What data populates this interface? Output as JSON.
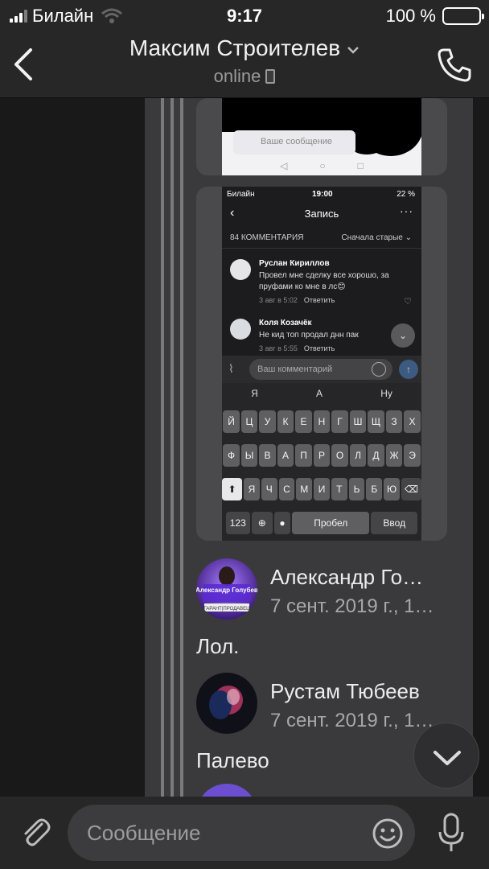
{
  "status_bar": {
    "carrier": "Билайн",
    "time": "9:17",
    "battery": "100 %"
  },
  "header": {
    "title": "Максим Строителев",
    "subtitle": "online"
  },
  "attachment_1": {
    "input_placeholder": "Ваше сообщение"
  },
  "attachment_2": {
    "status": {
      "carrier": "Билайн",
      "time": "19:00",
      "battery": "22 %"
    },
    "title": "Запись",
    "comments_count": "84 КОММЕНТАРИЯ",
    "sort": "Сначала старые",
    "comments": [
      {
        "author": "Руслан Кириллов",
        "text": "Провел мне сделку все хорошо, за пруфами ко мне в лс😊",
        "date": "3 авг в 5:02",
        "reply": "Ответить"
      },
      {
        "author": "Коля Козачёк",
        "text": "Не кид топ продал днн пак",
        "date": "3 авг в 5:55",
        "reply": "Ответить"
      }
    ],
    "input_placeholder": "Ваш комментарий",
    "suggestions": [
      "Я",
      "А",
      "Ну"
    ],
    "keyboard_rows": [
      [
        "Й",
        "Ц",
        "У",
        "К",
        "Е",
        "Н",
        "Г",
        "Ш",
        "Щ",
        "З",
        "Х"
      ],
      [
        "Ф",
        "Ы",
        "В",
        "А",
        "П",
        "Р",
        "О",
        "Л",
        "Д",
        "Ж",
        "Э"
      ],
      [
        "Я",
        "Ч",
        "С",
        "М",
        "И",
        "Т",
        "Ь",
        "Б",
        "Ю"
      ]
    ],
    "key_123": "123",
    "key_space": "Пробел",
    "key_enter": "Ввод"
  },
  "messages": [
    {
      "author": "Александр Го…",
      "date": "7 сент. 2019 г., 1…",
      "text": "Лол.",
      "avatar_label": "Александр Голубев",
      "avatar_sub": "ГАРАНТ|ПРОДАВЕЦ"
    },
    {
      "author": "Рустам Тюбеев",
      "date": "7 сент. 2019 г., 1…",
      "text": "Палево"
    }
  ],
  "compose": {
    "placeholder": "Сообщение"
  },
  "colors": {
    "bar_bg": "#272727",
    "thread_bg": "#3a3a3c",
    "bubble_bg": "#4a4a4c",
    "text": "#ececec",
    "muted": "#a8a8a8"
  },
  "icons": [
    "back-icon",
    "chevron-down-icon",
    "phone-call-icon",
    "paperclip-icon",
    "emoji-icon",
    "microphone-icon",
    "scroll-down-icon"
  ]
}
